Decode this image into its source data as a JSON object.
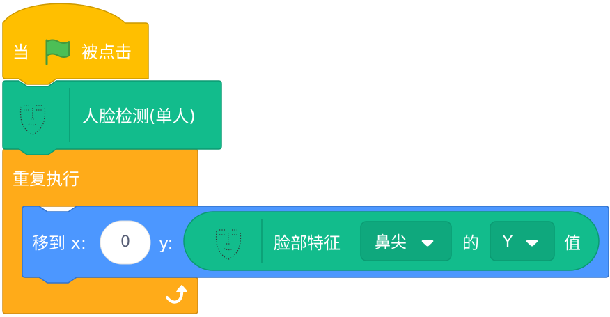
{
  "hat_block": {
    "prefix": "当",
    "suffix": "被点击",
    "icon": "green-flag-icon",
    "color": "#ffbf00"
  },
  "face_detect_block": {
    "label": "人脸检测(单人)",
    "icon": "face-mesh-icon",
    "color": "#12bc8c"
  },
  "forever_block": {
    "label": "重复执行",
    "icon": "loop-arrow-icon",
    "color": "#ffab19"
  },
  "goto_block": {
    "label": "移到 x:",
    "x_value": "0",
    "y_label": "y:",
    "color": "#4c97ff"
  },
  "face_feature_reporter": {
    "label": "脸部特征",
    "feature_dropdown": "鼻尖",
    "of_label": "的",
    "axis_dropdown": "Y",
    "value_label": "值",
    "icon": "face-mesh-icon",
    "color": "#12bc8c"
  }
}
